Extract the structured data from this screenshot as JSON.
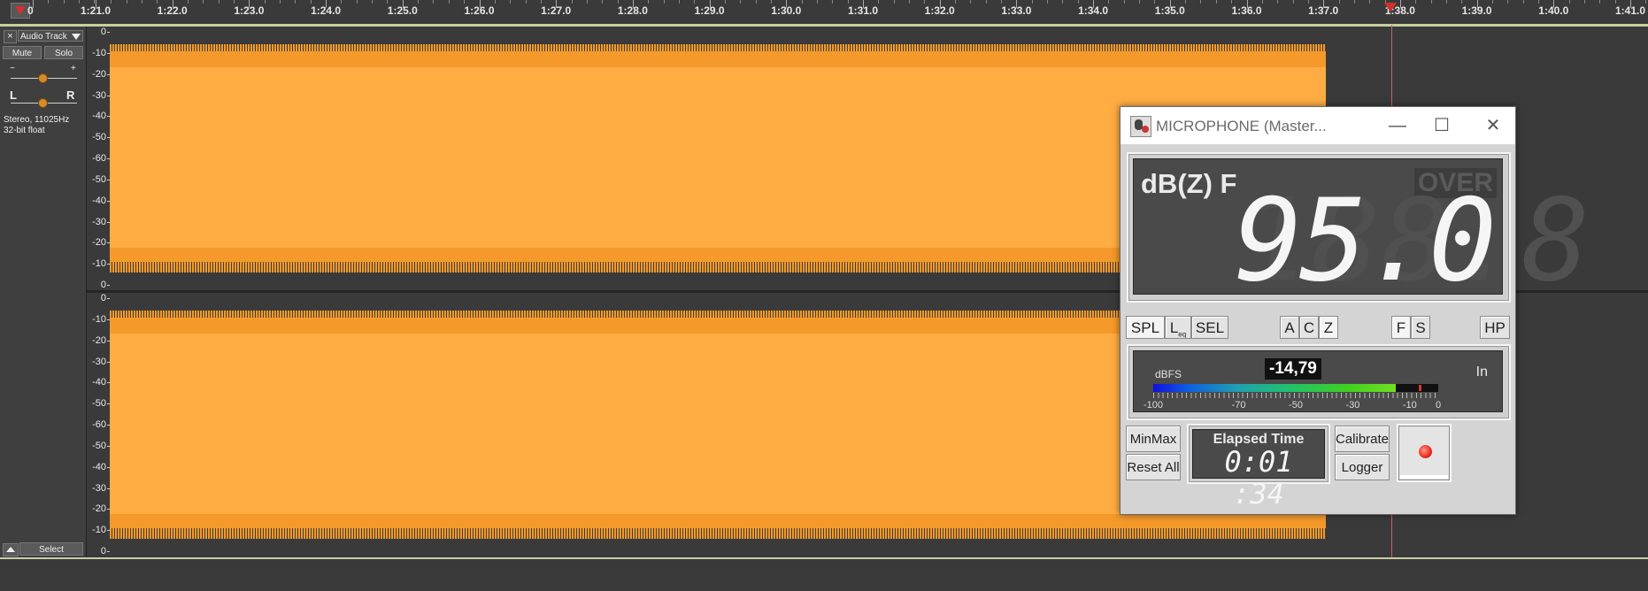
{
  "ruler": {
    "labels": [
      "0",
      "1:21.0",
      "1:22.0",
      "1:23.0",
      "1:24.0",
      "1:25.0",
      "1:26.0",
      "1:27.0",
      "1:28.0",
      "1:29.0",
      "1:30.0",
      "1:31.0",
      "1:32.0",
      "1:33.0",
      "1:34.0",
      "1:35.0",
      "1:36.0",
      "1:37.0",
      "1:38.0",
      "1:39.0",
      "1:40.0",
      "1:41.0"
    ]
  },
  "track": {
    "close_icon": "×",
    "name": "Audio Track",
    "mute_label": "Mute",
    "solo_label": "Solo",
    "gain_minus": "−",
    "gain_plus": "+",
    "pan_left": "L",
    "pan_right": "R",
    "info_line1": "Stereo, 11025Hz",
    "info_line2": "32-bit float",
    "select_label": "Select"
  },
  "vscale": {
    "labels": [
      "0",
      "-10",
      "-20",
      "-30",
      "-40",
      "-50",
      "-60",
      "-50",
      "-40",
      "-30",
      "-20",
      "-10",
      "0"
    ]
  },
  "colors": {
    "waveform": "#ffad42",
    "waveform_edge": "#f59a2a",
    "background": "#3a3a3a"
  },
  "mic": {
    "title": "MICROPHONE (Master...",
    "minimize_icon": "—",
    "maximize_icon": "☐",
    "close_icon": "✕",
    "unit": "dB(Z) F",
    "over": "OVER",
    "ghost_digits": "188.8",
    "value": "95.0",
    "buttons": {
      "spl": "SPL",
      "leq": "L",
      "leq_sub": "eq",
      "sel": "SEL",
      "a": "A",
      "c": "C",
      "z": "Z",
      "f": "F",
      "s": "S",
      "hp": "HP"
    },
    "level": {
      "label": "dBFS",
      "value": "-14,79",
      "input": "In",
      "fill_fraction": 0.85,
      "scale": [
        "-100",
        "-70",
        "-50",
        "-30",
        "-10",
        "0"
      ]
    },
    "minmax": "MinMax",
    "reset_all": "Reset All",
    "elapsed_label": "Elapsed Time",
    "elapsed_value": "0:01 :34",
    "calibrate": "Calibrate",
    "logger": "Logger"
  }
}
